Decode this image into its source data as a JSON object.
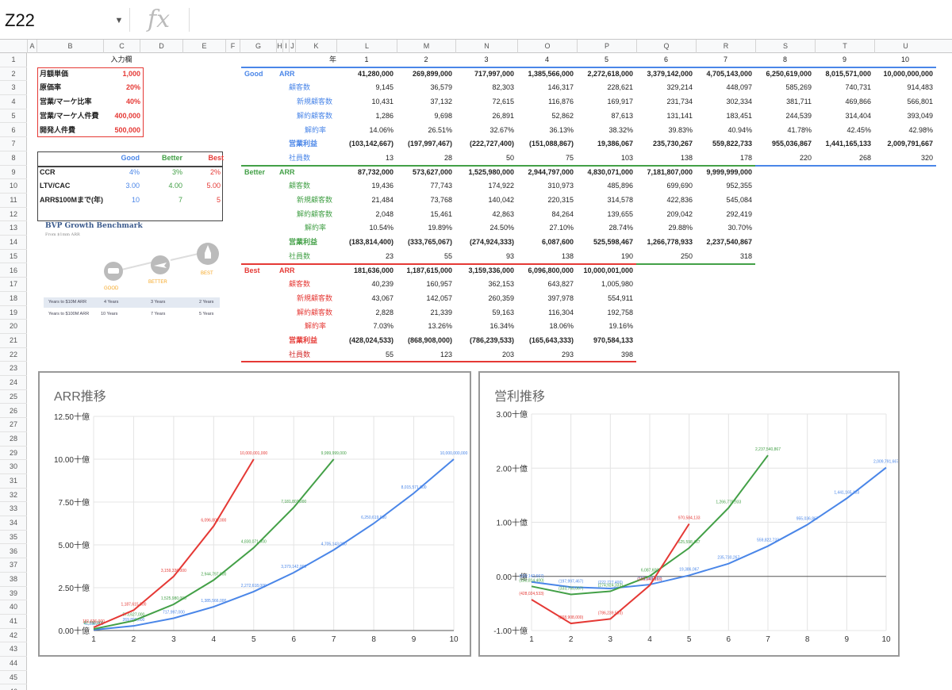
{
  "namebox": "Z22",
  "fx": "fx",
  "columns": [
    "A",
    "B",
    "C",
    "D",
    "E",
    "F",
    "G",
    "H",
    "I",
    "J",
    "K",
    "L",
    "M",
    "N",
    "O",
    "P",
    "Q",
    "R",
    "S",
    "T",
    "U"
  ],
  "rows": [
    "1",
    "2",
    "3",
    "4",
    "5",
    "6",
    "7",
    "8",
    "9",
    "10",
    "11",
    "12",
    "13",
    "14",
    "15",
    "16",
    "17",
    "18",
    "19",
    "20",
    "21",
    "22",
    "23",
    "24",
    "25",
    "26",
    "27",
    "28",
    "29",
    "30",
    "31",
    "32",
    "33",
    "34",
    "35",
    "36",
    "37",
    "38",
    "39",
    "40",
    "41",
    "42",
    "43",
    "44",
    "45",
    "46"
  ],
  "input": {
    "header": "入力欄",
    "rows": [
      {
        "label": "月額単価",
        "value": "1,000"
      },
      {
        "label": "原価率",
        "value": "20%"
      },
      {
        "label": "営業/マーケ比率",
        "value": "40%"
      },
      {
        "label": "営業/マーケ人件費",
        "value": "400,000"
      },
      {
        "label": "開発人件費",
        "value": "500,000"
      }
    ]
  },
  "bench": {
    "good": "Good",
    "better": "Better",
    "best": "Best",
    "rows": [
      {
        "label": "CCR",
        "good": "4%",
        "better": "3%",
        "best": "2%"
      },
      {
        "label": "LTV/CAC",
        "good": "3.00",
        "better": "4.00",
        "best": "5.00"
      },
      {
        "label": "ARR$100Mまで(年)",
        "good": "10",
        "better": "7",
        "best": "5"
      }
    ]
  },
  "bvp": {
    "title": "BVP Growth Benchmark",
    "subtitle": "From $1mm ARR",
    "good": "GOOD",
    "better": "BETTER",
    "best": "BEST",
    "r1": {
      "label": "Years to $10M ARR",
      "good": "4 Years",
      "better": "3 Years",
      "best": "2 Years"
    },
    "r2": {
      "label": "Years to $100M ARR",
      "good": "10 Years",
      "better": "7 Years",
      "best": "5 Years"
    }
  },
  "year_label": "年",
  "years": [
    "1",
    "2",
    "3",
    "4",
    "5",
    "6",
    "7",
    "8",
    "9",
    "10"
  ],
  "scenarios": [
    {
      "name": "Good",
      "color": "#4a86e8",
      "rows": [
        {
          "label": "ARR",
          "ind": 0,
          "bold": true,
          "vals": [
            "41,280,000",
            "269,899,000",
            "717,997,000",
            "1,385,566,000",
            "2,272,618,000",
            "3,379,142,000",
            "4,705,143,000",
            "6,250,619,000",
            "8,015,571,000",
            "10,000,000,000"
          ]
        },
        {
          "label": "顧客数",
          "ind": 1,
          "vals": [
            "9,145",
            "36,579",
            "82,303",
            "146,317",
            "228,621",
            "329,214",
            "448,097",
            "585,269",
            "740,731",
            "914,483"
          ]
        },
        {
          "label": "新規顧客数",
          "ind": 2,
          "vals": [
            "10,431",
            "37,132",
            "72,615",
            "116,876",
            "169,917",
            "231,734",
            "302,334",
            "381,711",
            "469,866",
            "566,801"
          ]
        },
        {
          "label": "解約顧客数",
          "ind": 2,
          "vals": [
            "1,286",
            "9,698",
            "26,891",
            "52,862",
            "87,613",
            "131,141",
            "183,451",
            "244,539",
            "314,404",
            "393,049"
          ]
        },
        {
          "label": "解約率",
          "ind": 3,
          "vals": [
            "14.06%",
            "26.51%",
            "32.67%",
            "36.13%",
            "38.32%",
            "39.83%",
            "40.94%",
            "41.78%",
            "42.45%",
            "42.98%"
          ]
        },
        {
          "label": "営業利益",
          "ind": 1,
          "bold": true,
          "vals": [
            "(103,142,667)",
            "(197,997,467)",
            "(222,727,400)",
            "(151,088,867)",
            "19,386,067",
            "235,730,267",
            "559,822,733",
            "955,036,867",
            "1,441,165,133",
            "2,009,791,667"
          ]
        },
        {
          "label": "社員数",
          "ind": 1,
          "vals": [
            "13",
            "28",
            "50",
            "75",
            "103",
            "138",
            "178",
            "220",
            "268",
            "320"
          ]
        }
      ]
    },
    {
      "name": "Better",
      "color": "#43a047",
      "rows": [
        {
          "label": "ARR",
          "ind": 0,
          "bold": true,
          "vals": [
            "87,732,000",
            "573,627,000",
            "1,525,980,000",
            "2,944,797,000",
            "4,830,071,000",
            "7,181,807,000",
            "9,999,999,000"
          ]
        },
        {
          "label": "顧客数",
          "ind": 1,
          "vals": [
            "19,436",
            "77,743",
            "174,922",
            "310,973",
            "485,896",
            "699,690",
            "952,355"
          ]
        },
        {
          "label": "新規顧客数",
          "ind": 2,
          "vals": [
            "21,484",
            "73,768",
            "140,042",
            "220,315",
            "314,578",
            "422,836",
            "545,084"
          ]
        },
        {
          "label": "解約顧客数",
          "ind": 2,
          "vals": [
            "2,048",
            "15,461",
            "42,863",
            "84,264",
            "139,655",
            "209,042",
            "292,419"
          ]
        },
        {
          "label": "解約率",
          "ind": 3,
          "vals": [
            "10.54%",
            "19.89%",
            "24.50%",
            "27.10%",
            "28.74%",
            "29.88%",
            "30.70%"
          ]
        },
        {
          "label": "営業利益",
          "ind": 1,
          "bold": true,
          "vals": [
            "(183,814,400)",
            "(333,765,067)",
            "(274,924,333)",
            "6,087,600",
            "525,598,467",
            "1,266,778,933",
            "2,237,540,867"
          ]
        },
        {
          "label": "社員数",
          "ind": 1,
          "vals": [
            "23",
            "55",
            "93",
            "138",
            "190",
            "250",
            "318"
          ]
        }
      ]
    },
    {
      "name": "Best",
      "color": "#e53935",
      "rows": [
        {
          "label": "ARR",
          "ind": 0,
          "bold": true,
          "vals": [
            "181,636,000",
            "1,187,615,000",
            "3,159,336,000",
            "6,096,800,000",
            "10,000,001,000"
          ]
        },
        {
          "label": "顧客数",
          "ind": 1,
          "vals": [
            "40,239",
            "160,957",
            "362,153",
            "643,827",
            "1,005,980"
          ]
        },
        {
          "label": "新規顧客数",
          "ind": 2,
          "vals": [
            "43,067",
            "142,057",
            "260,359",
            "397,978",
            "554,911"
          ]
        },
        {
          "label": "解約顧客数",
          "ind": 2,
          "vals": [
            "2,828",
            "21,339",
            "59,163",
            "116,304",
            "192,758"
          ]
        },
        {
          "label": "解約率",
          "ind": 3,
          "vals": [
            "7.03%",
            "13.26%",
            "16.34%",
            "18.06%",
            "19.16%"
          ]
        },
        {
          "label": "営業利益",
          "ind": 1,
          "bold": true,
          "vals": [
            "(428,024,533)",
            "(868,908,000)",
            "(786,239,533)",
            "(165,643,333)",
            "970,584,133"
          ]
        },
        {
          "label": "社員数",
          "ind": 1,
          "vals": [
            "55",
            "123",
            "203",
            "293",
            "398"
          ]
        }
      ]
    }
  ],
  "colors": {
    "good": "#4a86e8",
    "better": "#43a047",
    "best": "#e53935"
  },
  "chart_data": [
    {
      "type": "line",
      "title": "ARR推移",
      "x": [
        1,
        2,
        3,
        4,
        5,
        6,
        7,
        8,
        9,
        10
      ],
      "ylim": [
        0,
        12.5
      ],
      "yticks": [
        "0.00十億",
        "2.50十億",
        "5.00十億",
        "7.50十億",
        "10.00十億",
        "12.50十億"
      ],
      "yvals": [
        0,
        2.5,
        5,
        7.5,
        10,
        12.5
      ],
      "series": [
        {
          "key": "good",
          "values": [
            0.04128,
            0.269899,
            0.717997,
            1.385566,
            2.272618,
            3.379142,
            4.705143,
            6.250619,
            8.015571,
            10.0
          ],
          "labels": [
            "41,280,000",
            "269,899,000",
            "717,997,000",
            "1,385,566,000",
            "2,272,618,000",
            "3,379,142,000",
            "4,705,143,000",
            "6,250,619,000",
            "8,015,571,000",
            "10,000,000,000"
          ]
        },
        {
          "key": "better",
          "values": [
            0.087732,
            0.573627,
            1.52598,
            2.944797,
            4.830071,
            7.181807,
            9.999999
          ],
          "labels": [
            "87,732,000",
            "573,627,000",
            "1,525,980,000",
            "2,944,797,000",
            "4,830,071,000",
            "7,181,807,000",
            "9,999,999,000"
          ]
        },
        {
          "key": "best",
          "values": [
            0.181636,
            1.187615,
            3.159336,
            6.0968,
            10.000001
          ],
          "labels": [
            "181,636,000",
            "1,187,615,000",
            "3,159,336,000",
            "6,096,800,000",
            "10,000,001,000"
          ]
        }
      ]
    },
    {
      "type": "line",
      "title": "営利推移",
      "x": [
        1,
        2,
        3,
        4,
        5,
        6,
        7,
        8,
        9,
        10
      ],
      "ylim": [
        -1,
        3
      ],
      "yticks": [
        "-1.00十億",
        "0.00十億",
        "1.00十億",
        "2.00十億",
        "3.00十億"
      ],
      "yvals": [
        -1,
        0,
        1,
        2,
        3
      ],
      "series": [
        {
          "key": "good",
          "values": [
            -0.103143,
            -0.197997,
            -0.222727,
            -0.151089,
            0.019386,
            0.23573,
            0.559823,
            0.955037,
            1.441165,
            2.009792
          ],
          "labels": [
            "(103,142,667)",
            "(197,997,467)",
            "(222,727,400)",
            "(151,088,867)",
            "19,386,067",
            "235,730,267",
            "559,822,733",
            "955,036,867",
            "1,441,165,133",
            "2,009,791,667"
          ]
        },
        {
          "key": "better",
          "values": [
            -0.183814,
            -0.333765,
            -0.274924,
            0.006088,
            0.525598,
            1.266779,
            2.237541
          ],
          "labels": [
            "(183,814,400)",
            "(333,765,067)",
            "(274,924,333)",
            "6,087,600",
            "525,598,467",
            "1,266,778,933",
            "2,237,540,867"
          ]
        },
        {
          "key": "best",
          "values": [
            -0.428025,
            -0.868908,
            -0.78624,
            -0.165643,
            0.970584
          ],
          "labels": [
            "(428,024,533)",
            "(868,908,000)",
            "(786,239,533)",
            "(165,643,333)",
            "970,584,133"
          ]
        }
      ]
    }
  ]
}
